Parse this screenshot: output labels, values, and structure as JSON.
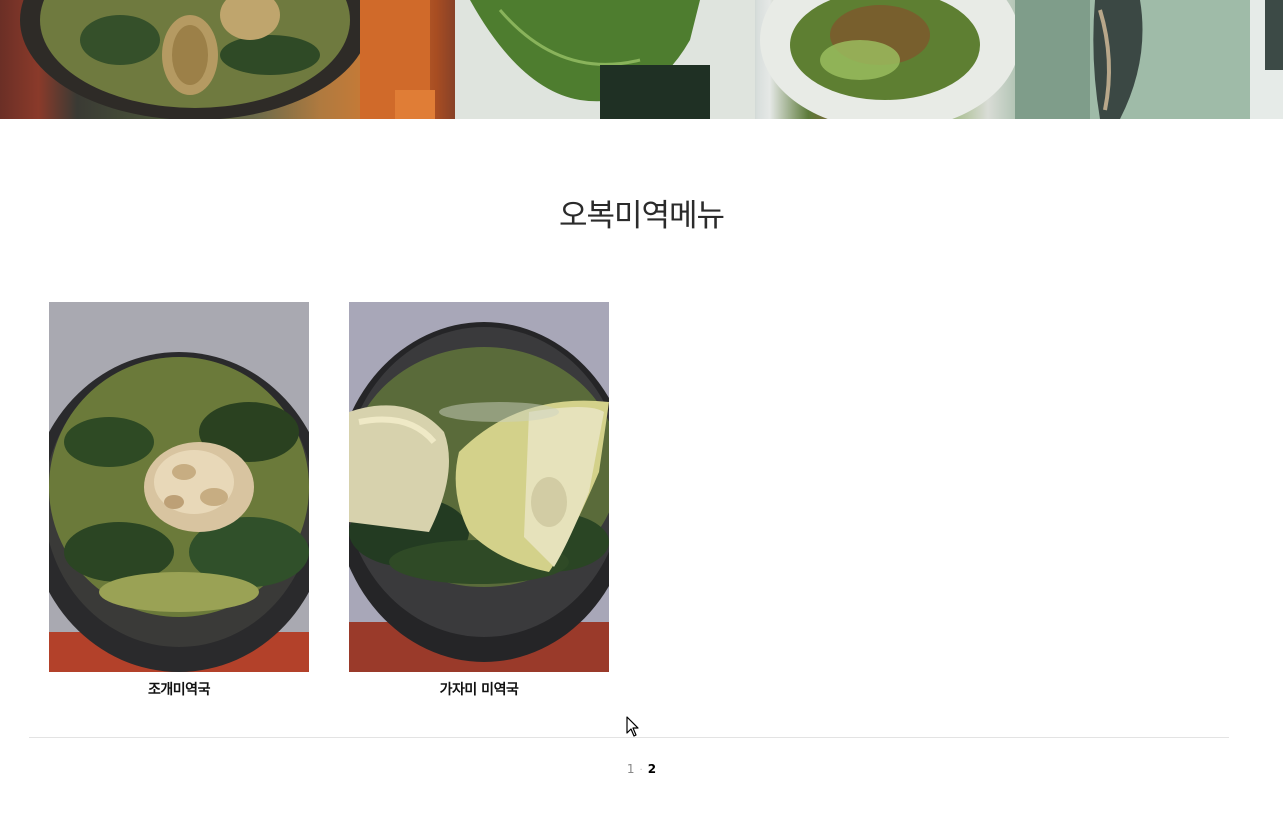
{
  "page": {
    "title": "오복미역메뉴"
  },
  "menu_items": [
    {
      "caption": "조개미역국",
      "image": "clam-seaweed-soup-photo"
    },
    {
      "caption": "가자미 미역국",
      "image": "flounder-seaweed-soup-photo"
    }
  ],
  "pagination": {
    "pages": [
      "1",
      "2"
    ],
    "current": "2",
    "separator": "·"
  },
  "colors": {
    "title": "#2b2b2b",
    "divider": "#e3e3e3",
    "page_inactive": "#888888",
    "page_active": "#000000"
  }
}
